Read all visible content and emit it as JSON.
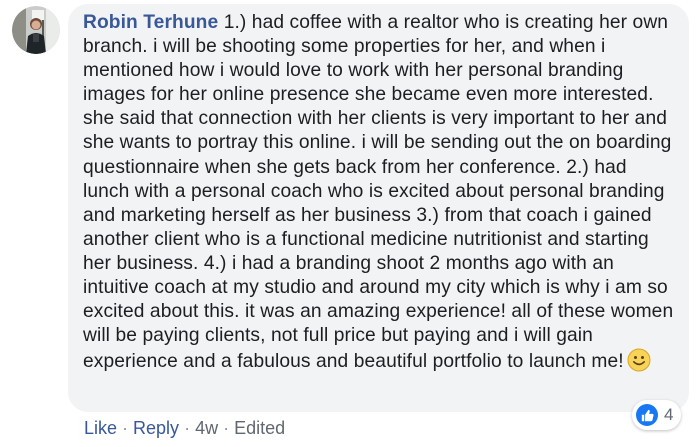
{
  "comment": {
    "author": "Robin Terhune",
    "text": "1.) had coffee with a realtor who is creating her own branch. i will be shooting some properties for her, and when i mentioned how i would love to work with her personal branding images for her online presence she became even more interested. she said that connection with her clients is very important to her and she wants to portray this online. i will be sending out the on boarding questionnaire when she gets back from her conference. 2.) had lunch with a personal coach who is excited about personal branding and marketing herself as her business 3.) from that coach i gained another client who is a functional medicine nutritionist and starting her business. 4.) i had a branding shoot 2 months ago with an intuitive coach at my studio and around my city which is why i am so excited about this. it was an amazing experience! all of these women will be paying clients, not full price but paying and i will gain experience and a fabulous and beautiful portfolio to launch me!",
    "emoji": "smiley-face"
  },
  "reactions": {
    "icon": "thumbs-up-icon",
    "count": "4",
    "color": "#1877f2"
  },
  "actions": {
    "like": "Like",
    "reply": "Reply",
    "time": "4w",
    "edited": "Edited",
    "separator": "·"
  },
  "colors": {
    "author_link": "#385898",
    "bubble_bg": "#f2f3f5",
    "meta_text": "#606770"
  }
}
